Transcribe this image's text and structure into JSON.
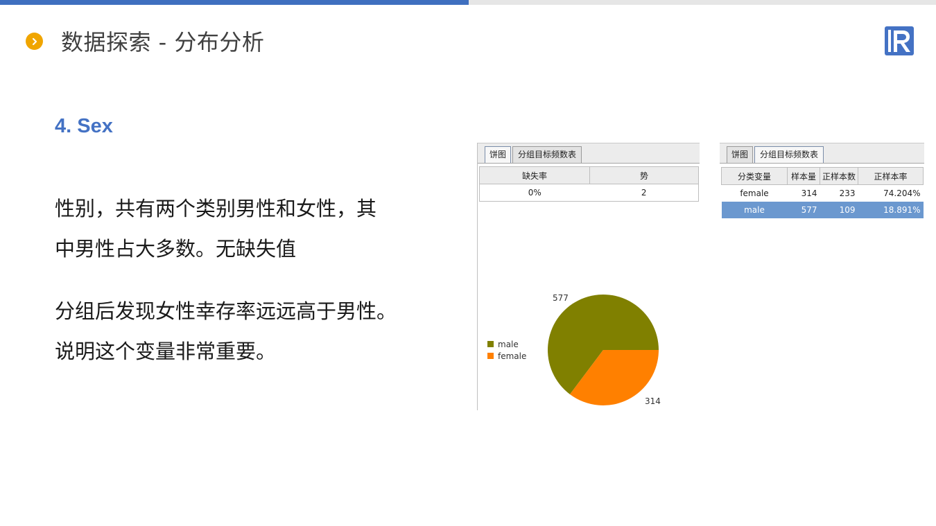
{
  "header": {
    "title": "数据探索 - 分布分析",
    "logo_letter": "R",
    "accent": "#4472c4"
  },
  "content": {
    "heading": "4. Sex",
    "para1_line1": "性别，共有两个类别男性和女性，其",
    "para1_line2": "中男性占大多数。无缺失值",
    "para2_line1": "分组后发现女性幸存率远远高于男性。",
    "para2_line2": "说明这个变量非常重要。"
  },
  "left_widget": {
    "tabs": [
      "饼图",
      "分组目标频数表"
    ],
    "columns": [
      "缺失率",
      "势"
    ],
    "row": [
      "0%",
      "2"
    ],
    "legend": [
      {
        "label": "male",
        "color": "#808000"
      },
      {
        "label": "female",
        "color": "#ff8000"
      }
    ]
  },
  "right_widget": {
    "tabs": [
      "饼图",
      "分组目标频数表"
    ],
    "columns": [
      "分类变量",
      "样本量",
      "正样本数",
      "正样本率"
    ],
    "rows": [
      [
        "female",
        "314",
        "233",
        "74.204%"
      ],
      [
        "male",
        "577",
        "109",
        "18.891%"
      ]
    ]
  },
  "chart_data": {
    "type": "pie",
    "slices": [
      {
        "label": "male",
        "value": 577,
        "color": "#808000"
      },
      {
        "label": "female",
        "value": 314,
        "color": "#ff8000"
      }
    ],
    "legend": "left"
  }
}
